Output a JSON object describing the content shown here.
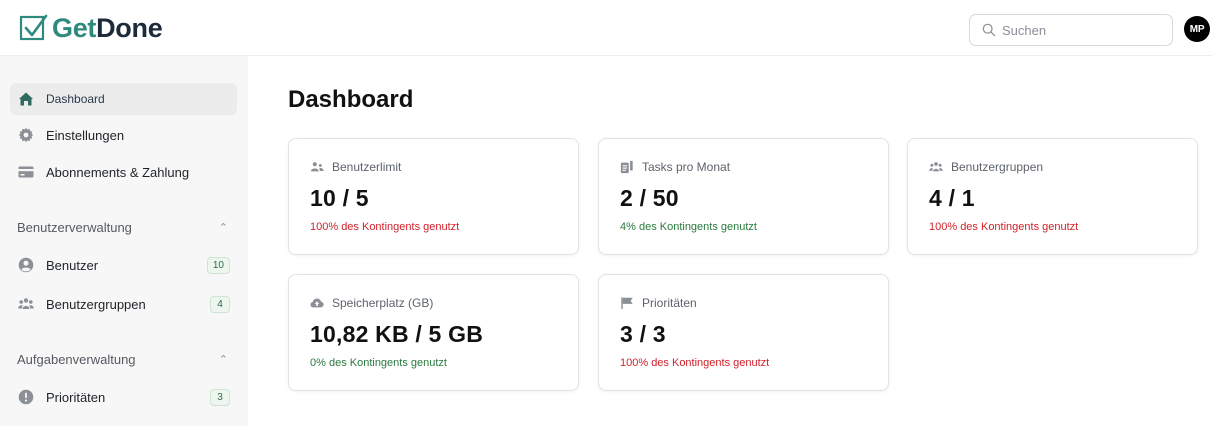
{
  "brand": {
    "get": "Get",
    "done": "Done"
  },
  "search": {
    "placeholder": "Suchen",
    "value": ""
  },
  "user": {
    "initials": "MP"
  },
  "sidebar": {
    "items": [
      {
        "label": "Dashboard",
        "icon": "home-icon",
        "active": true
      },
      {
        "label": "Einstellungen",
        "icon": "gear-icon"
      },
      {
        "label": "Abonnements & Zahlung",
        "icon": "credit-card-icon"
      }
    ],
    "user_section": {
      "title": "Benutzerverwaltung",
      "items": [
        {
          "label": "Benutzer",
          "icon": "user-icon",
          "count": "10"
        },
        {
          "label": "Benutzergruppen",
          "icon": "users-icon",
          "count": "4"
        }
      ]
    },
    "task_section": {
      "title": "Aufgabenverwaltung",
      "items": [
        {
          "label": "Prioritäten",
          "icon": "alert-circle-icon",
          "count": "3"
        }
      ]
    }
  },
  "main": {
    "title": "Dashboard",
    "cards": [
      {
        "label": "Benutzerlimit",
        "icon": "users-icon",
        "value": "10 / 5",
        "note": "100% des Kontingents genutzt",
        "status": "red"
      },
      {
        "label": "Tasks pro Monat",
        "icon": "tasks-icon",
        "value": "2 / 50",
        "note": "4% des Kontingents genutzt",
        "status": "green"
      },
      {
        "label": "Benutzergruppen",
        "icon": "group-icon",
        "value": "4 / 1",
        "note": "100% des Kontingents genutzt",
        "status": "red"
      },
      {
        "label": "Speicherplatz (GB)",
        "icon": "cloud-upload-icon",
        "value": "10,82 KB / 5 GB",
        "note": "0% des Kontingents genutzt",
        "status": "green"
      },
      {
        "label": "Prioritäten",
        "icon": "flag-icon",
        "value": "3 / 3",
        "note": "100% des Kontingents genutzt",
        "status": "red"
      }
    ]
  },
  "colors": {
    "accent": "#2f8a7e",
    "danger": "#d0222a",
    "success": "#2a7a3f",
    "sidebar_bg": "#f7f7f7"
  }
}
